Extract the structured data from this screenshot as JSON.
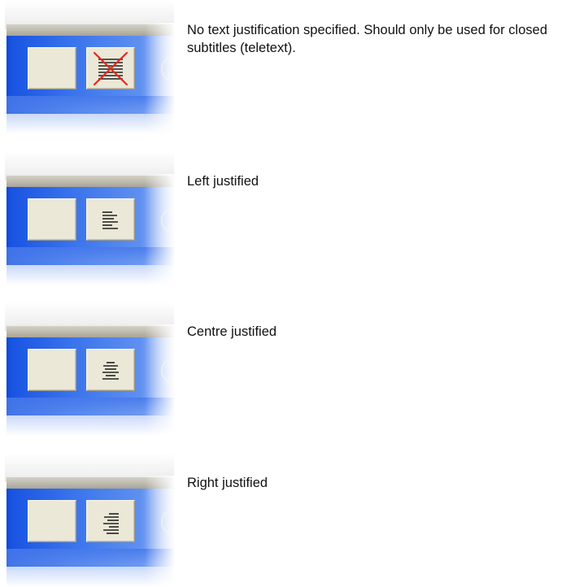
{
  "entries": [
    {
      "icon": "no-justification-icon",
      "description": "No text justification specified. Should only be used for closed subtitles (teletext)."
    },
    {
      "icon": "align-left-icon",
      "description": "Left justified"
    },
    {
      "icon": "align-center-icon",
      "description": "Centre justified"
    },
    {
      "icon": "align-right-icon",
      "description": "Right justified"
    }
  ],
  "colors": {
    "toolbar_blue": "#1954e2",
    "button_face": "#ebe8d7",
    "cross_red": "#e8261f",
    "text": "#111111"
  }
}
